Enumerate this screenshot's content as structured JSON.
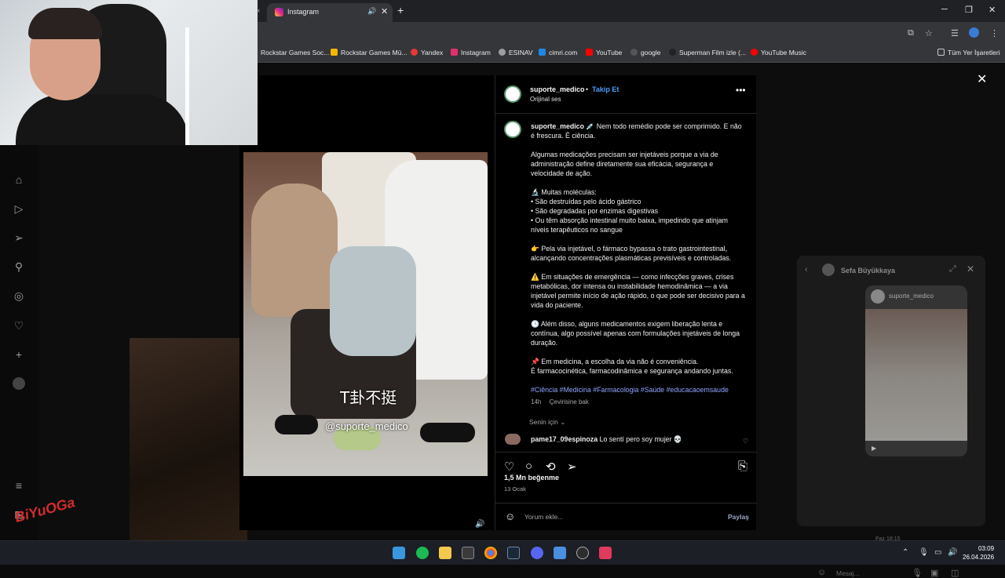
{
  "browser": {
    "tab_title": "Instagram",
    "bookmarks": [
      {
        "label": "Rockstar Games Soc...",
        "color": "#f5b700"
      },
      {
        "label": "Rockstar Games Mü...",
        "color": "#f5b700"
      },
      {
        "label": "Yandex",
        "color": "#e53935"
      },
      {
        "label": "Instagram",
        "color": "#e1306c"
      },
      {
        "label": "ESINAV",
        "color": "#9e9e9e"
      },
      {
        "label": "cimri.com",
        "color": "#1e88e5"
      },
      {
        "label": "YouTube",
        "color": "#ff0000"
      },
      {
        "label": "google",
        "color": "#555555"
      },
      {
        "label": "Superman Film izle (...",
        "color": "#222222"
      },
      {
        "label": "YouTube Music",
        "color": "#ff0000"
      }
    ],
    "all_bookmarks": "Tüm Yer İşaretleri"
  },
  "video": {
    "overlay_text": "T卦不挺",
    "watermark": "@suporte_medico"
  },
  "post": {
    "username": "suporte_medico",
    "follow_label": "Takip Et",
    "separator": "•",
    "audio": "Orijinal ses",
    "caption_username": "suporte_medico",
    "caption_paragraphs": [
      "💉 Nem todo remédio pode ser comprimido. E não é frescura. É ciência.",
      "Algumas medicações precisam ser injetáveis porque a via de administração define diretamente sua eficácia, segurança e velocidade de ação.",
      "🔬 Muitas moléculas:\n• São destruídas pelo ácido gástrico\n• São degradadas por enzimas digestivas\n• Ou têm absorção intestinal muito baixa, impedindo que atinjam níveis terapêuticos no sangue",
      "👉 Pela via injetável, o fármaco bypassa o trato gastrointestinal, alcançando concentrações plasmáticas previsíveis e controladas.",
      "⚠️ Em situações de emergência — como infecções graves, crises metabólicas, dor intensa ou instabilidade hemodinâmica — a via injetável permite início de ação rápido, o que pode ser decisivo para a vida do paciente.",
      "🕒 Além disso, alguns medicamentos exigem liberação lenta e contínua, algo possível apenas com formulações injetáveis de longa duração.",
      "📌 Em medicina, a escolha da via não é conveniência.\nÉ farmacocinética, farmacodinâmica e segurança andando juntas."
    ],
    "hashtags": "#Ciência #Medicina #Farmacologia #Saúde #educacaoemsaude",
    "age": "14h",
    "translate": "Çevirisine bak",
    "for_you": "Senin için",
    "comment_user": "pame17_09espinoza",
    "comment_text": "Lo sentí pero soy mujer 💀",
    "likes": "1,5 Mn beğenme",
    "date": "13 Ocak",
    "comment_placeholder": "Yorum ekle...",
    "share": "Paylaş"
  },
  "dm": {
    "name": "Sefa Büyükkaya",
    "card_user": "suporte_medico",
    "time": "Paz 18:15",
    "message_placeholder": "Mesaj..."
  },
  "logo_text": "BiYuOGa",
  "clock": {
    "time": "03:09",
    "date": "26.04.2026"
  }
}
